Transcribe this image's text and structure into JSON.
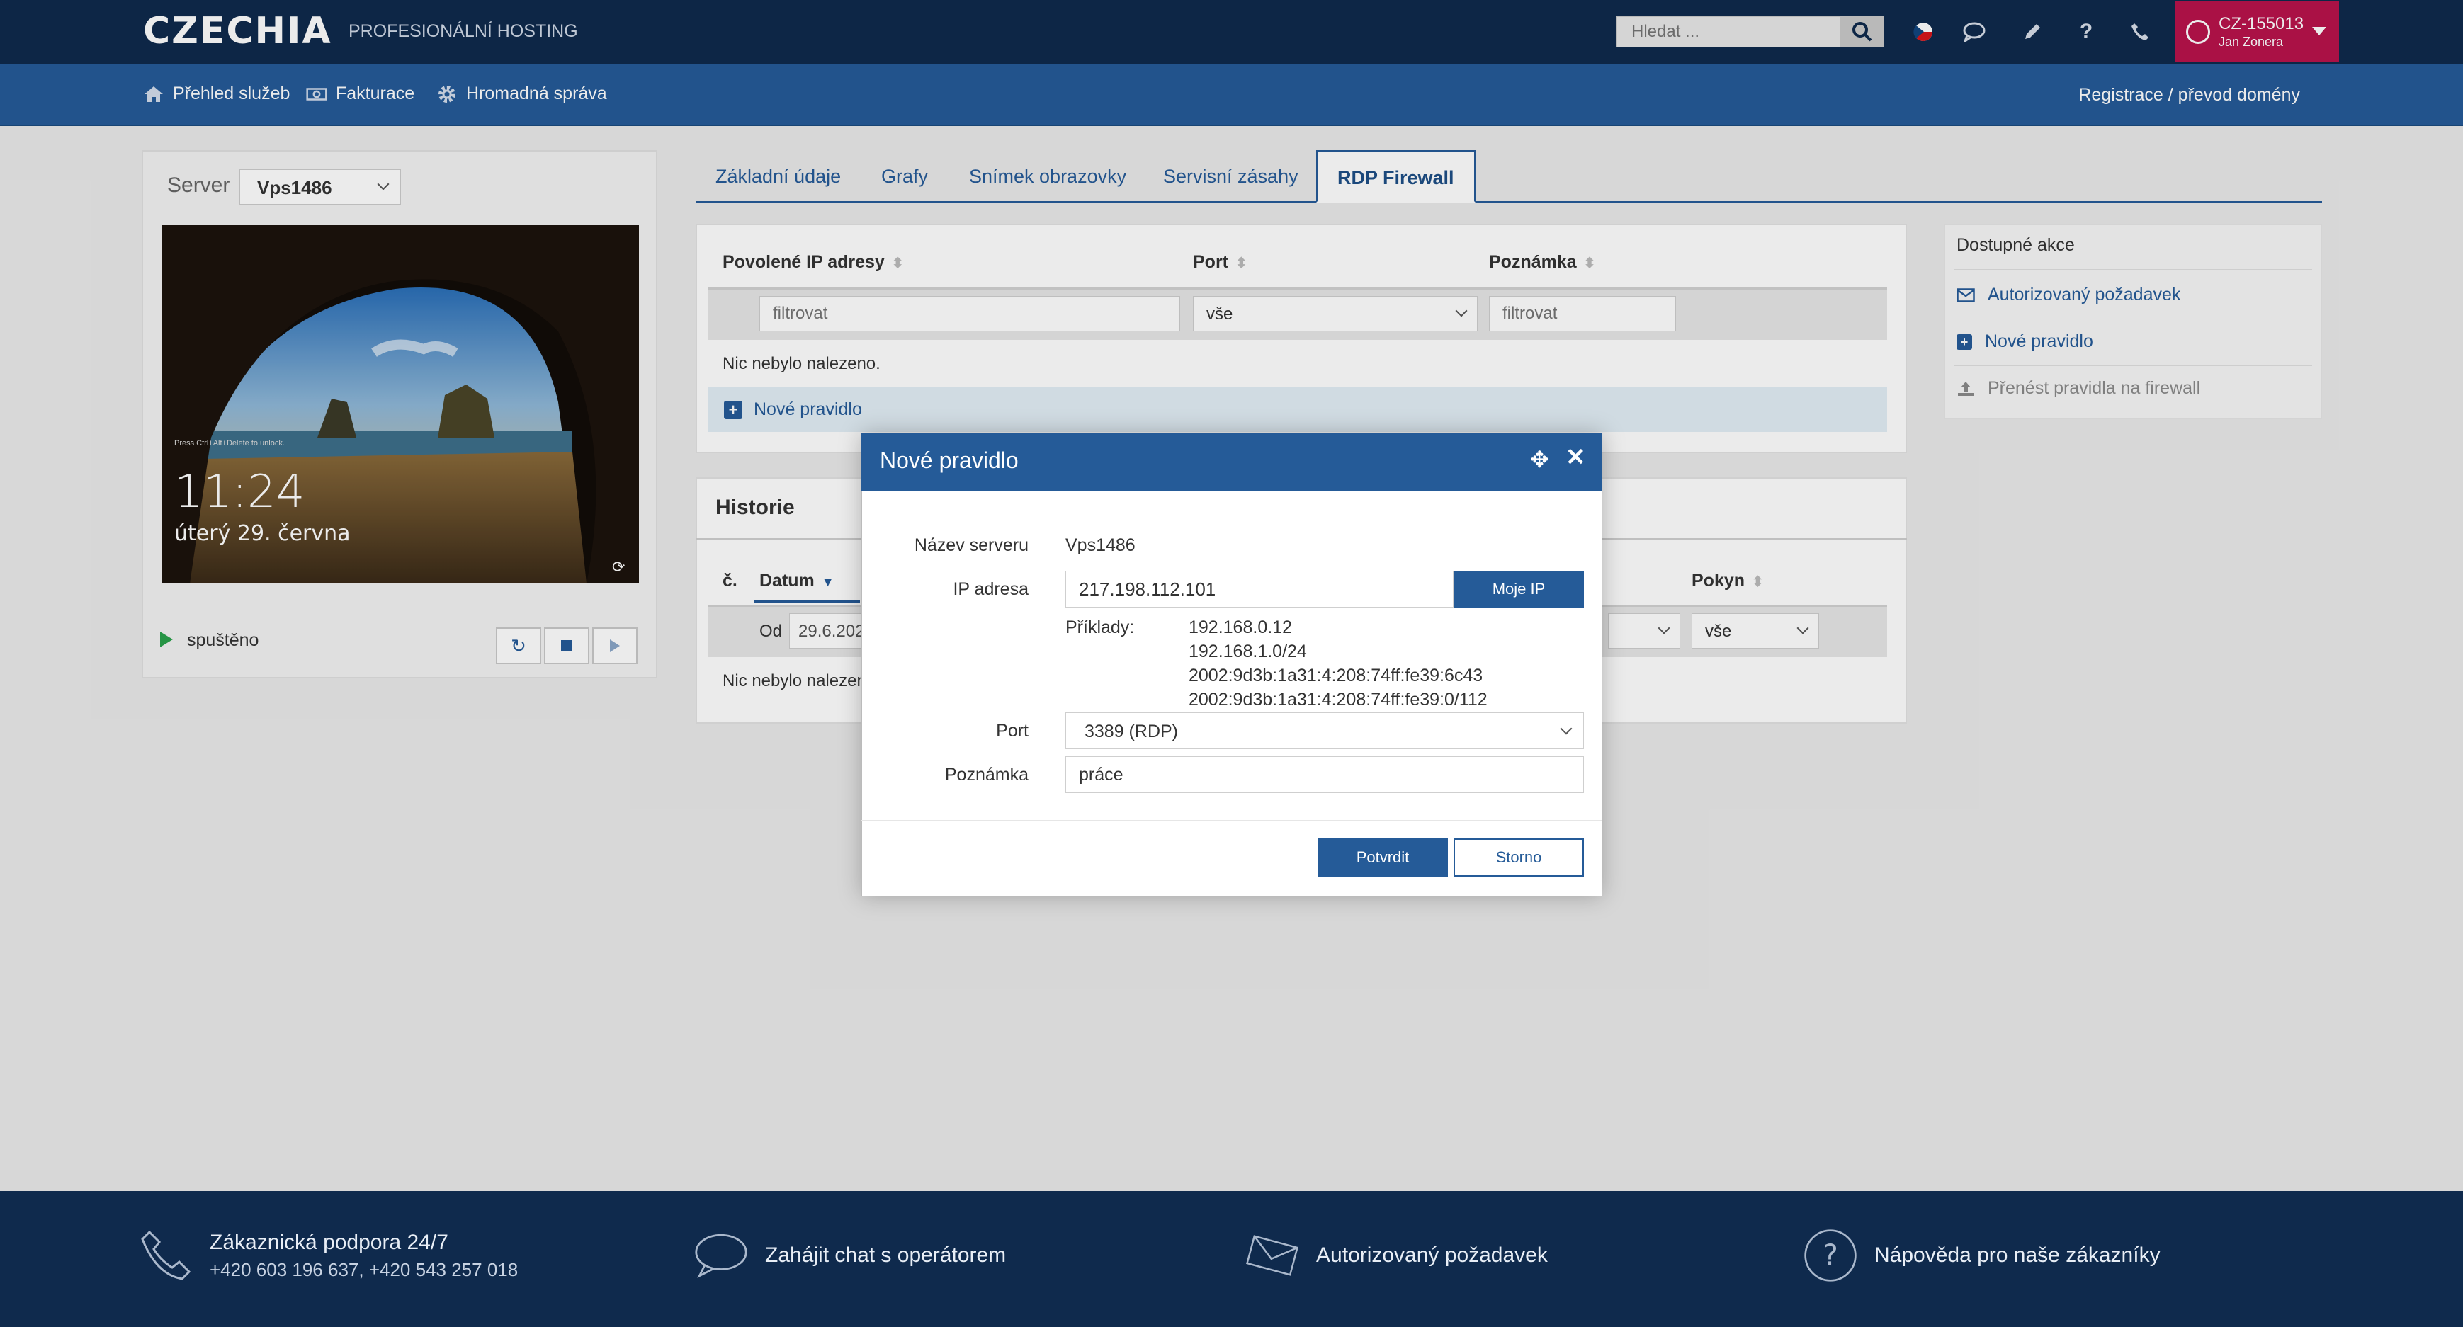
{
  "header": {
    "logo": "CZECHIA",
    "subtitle": "PROFESIONÁLNÍ HOSTING",
    "search_placeholder": "Hledat ...",
    "account_id": "CZ-155013",
    "account_name": "Jan Zonera",
    "icons": [
      "search-icon",
      "czech-flag-icon",
      "chat-icon",
      "pencil-icon",
      "help-icon",
      "phone-icon",
      "user-icon"
    ]
  },
  "nav": {
    "items": [
      {
        "label": "Přehled služeb",
        "icon": "home-icon"
      },
      {
        "label": "Fakturace",
        "icon": "money-icon"
      },
      {
        "label": "Hromadná správa",
        "icon": "gear-icon"
      }
    ],
    "register": "Registrace / převod domény"
  },
  "server": {
    "label": "Server",
    "selected": "Vps1486",
    "screen_time": "11:24",
    "screen_date": "úterý 29. června",
    "screen_hint": "Press Ctrl+Alt+Delete to unlock.",
    "status": "spuštěno"
  },
  "tabs": [
    {
      "label": "Základní údaje"
    },
    {
      "label": "Grafy"
    },
    {
      "label": "Snímek obrazovky"
    },
    {
      "label": "Servisní zásahy"
    },
    {
      "label": "RDP Firewall",
      "active": true
    }
  ],
  "firewall": {
    "columns": [
      "Povolené IP adresy",
      "Port",
      "Poznámka"
    ],
    "filter_placeholder": "filtrovat",
    "port_filter": "vše",
    "empty": "Nic nebylo nalezeno.",
    "new_rule": "Nové pravidlo"
  },
  "history": {
    "title": "Historie",
    "col_number": "č.",
    "col_date": "Datum",
    "col_command": "Pokyn",
    "from_label": "Od",
    "from_value": "29.6.202",
    "command_filter": "vše",
    "empty": "Nic nebylo nalezen"
  },
  "actions": {
    "title": "Dostupné akce",
    "items": [
      {
        "label": "Autorizovaný požadavek",
        "icon": "envelope-icon"
      },
      {
        "label": "Nové pravidlo",
        "icon": "plus-icon"
      },
      {
        "label": "Přenést pravidla na firewall",
        "icon": "upload-icon"
      }
    ]
  },
  "modal": {
    "title": "Nové pravidlo",
    "server_label": "Název serveru",
    "server_value": "Vps1486",
    "ip_label": "IP adresa",
    "ip_value": "217.198.112.101",
    "my_ip": "Moje IP",
    "examples_label": "Příklady:",
    "examples": [
      "192.168.0.12",
      "192.168.1.0/24",
      "2002:9d3b:1a31:4:208:74ff:fe39:6c43",
      "2002:9d3b:1a31:4:208:74ff:fe39:0/112"
    ],
    "port_label": "Port",
    "port_value": "3389 (RDP)",
    "note_label": "Poznámka",
    "note_value": "práce",
    "confirm": "Potvrdit",
    "cancel": "Storno"
  },
  "footer": {
    "support_title": "Zákaznická podpora 24/7",
    "support_phones": "+420 603 196 637, +420 543 257 018",
    "chat": "Zahájit chat s operátorem",
    "authorized": "Autorizovaný požadavek",
    "help": "Nápověda pro naše zákazníky"
  },
  "colors": {
    "header_bg": "#0f2a4d",
    "nav_bg": "#255b98",
    "accent": "#255b98",
    "account_bg": "#b9134b",
    "status_green": "#2aa14b"
  }
}
